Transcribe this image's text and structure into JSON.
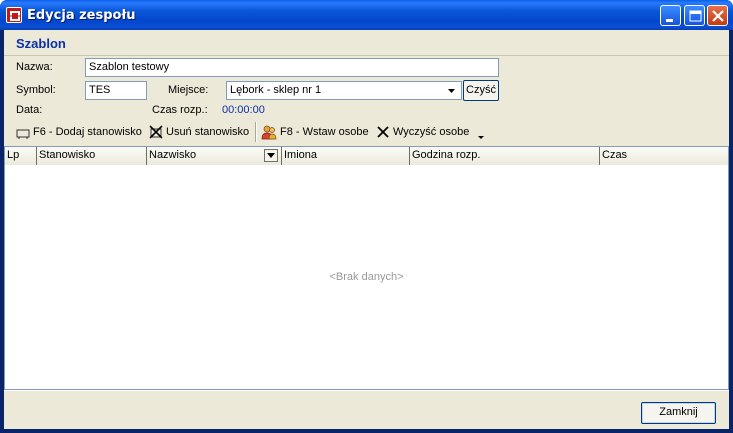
{
  "window": {
    "title": "Edycja zespołu"
  },
  "header": {
    "section_title": "Szablon"
  },
  "form": {
    "name_label": "Nazwa:",
    "name_value": "Szablon testowy",
    "symbol_label": "Symbol:",
    "symbol_value": "TES",
    "place_label": "Miejsce:",
    "place_value": "Lębork - sklep nr 1",
    "clear_button": "Czyść",
    "date_label": "Data:",
    "start_time_label": "Czas rozp.:",
    "start_time_value": "00:00:00"
  },
  "toolbar": {
    "add_position": "F6 - Dodaj stanowisko",
    "remove_position": "Usuń stanowisko",
    "insert_person": "F8 - Wstaw osobe",
    "clear_person": "Wyczyść osobe"
  },
  "grid": {
    "columns": [
      "Lp",
      "Stanowisko",
      "Nazwisko",
      "Imiona",
      "Godzina rozp.",
      "Czas"
    ],
    "empty_text": "<Brak danych>"
  },
  "footer": {
    "close_button": "Zamknij"
  },
  "icons": [
    "app-icon",
    "minimize-icon",
    "maximize-icon",
    "close-icon",
    "add-position-icon",
    "remove-position-icon",
    "insert-person-icon",
    "clear-person-icon",
    "dropdown-arrow-icon",
    "filter-icon",
    "toolbar-overflow-icon"
  ]
}
